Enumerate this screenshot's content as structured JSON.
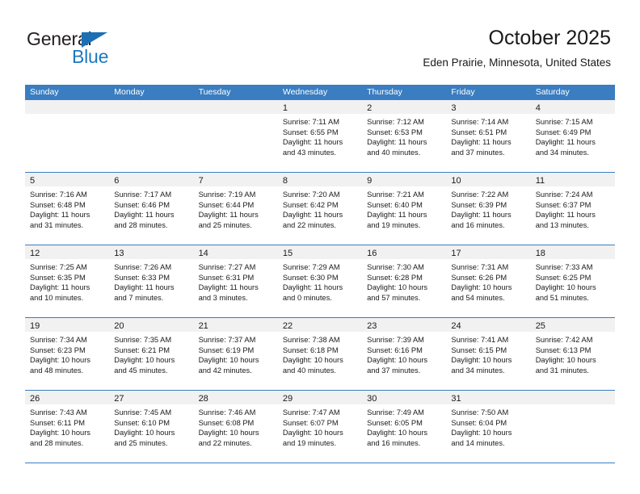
{
  "brand": {
    "word_top": "General",
    "word_bottom": "Blue",
    "triangle_color": "#1c6fb4",
    "blue_text_color": "#1c79c0",
    "icon": "general-blue-logo"
  },
  "header": {
    "title": "October 2025",
    "subtitle": "Eden Prairie, Minnesota, United States"
  },
  "theme": {
    "header_bar_color": "#3a7dc0",
    "daynum_band_color": "#f1f1f1",
    "grid_line_color": "#3a7dc0",
    "text_color": "#1a1a1a"
  },
  "calendar": {
    "weekday_headers": [
      "Sunday",
      "Monday",
      "Tuesday",
      "Wednesday",
      "Thursday",
      "Friday",
      "Saturday"
    ],
    "weeks": [
      [
        {
          "day": "",
          "empty": true,
          "sunrise": "",
          "sunset": "",
          "daylight_line1": "",
          "daylight_line2": ""
        },
        {
          "day": "",
          "empty": true,
          "sunrise": "",
          "sunset": "",
          "daylight_line1": "",
          "daylight_line2": ""
        },
        {
          "day": "",
          "empty": true,
          "sunrise": "",
          "sunset": "",
          "daylight_line1": "",
          "daylight_line2": ""
        },
        {
          "day": "1",
          "empty": false,
          "sunrise": "Sunrise: 7:11 AM",
          "sunset": "Sunset: 6:55 PM",
          "daylight_line1": "Daylight: 11 hours",
          "daylight_line2": "and 43 minutes."
        },
        {
          "day": "2",
          "empty": false,
          "sunrise": "Sunrise: 7:12 AM",
          "sunset": "Sunset: 6:53 PM",
          "daylight_line1": "Daylight: 11 hours",
          "daylight_line2": "and 40 minutes."
        },
        {
          "day": "3",
          "empty": false,
          "sunrise": "Sunrise: 7:14 AM",
          "sunset": "Sunset: 6:51 PM",
          "daylight_line1": "Daylight: 11 hours",
          "daylight_line2": "and 37 minutes."
        },
        {
          "day": "4",
          "empty": false,
          "sunrise": "Sunrise: 7:15 AM",
          "sunset": "Sunset: 6:49 PM",
          "daylight_line1": "Daylight: 11 hours",
          "daylight_line2": "and 34 minutes."
        }
      ],
      [
        {
          "day": "5",
          "empty": false,
          "sunrise": "Sunrise: 7:16 AM",
          "sunset": "Sunset: 6:48 PM",
          "daylight_line1": "Daylight: 11 hours",
          "daylight_line2": "and 31 minutes."
        },
        {
          "day": "6",
          "empty": false,
          "sunrise": "Sunrise: 7:17 AM",
          "sunset": "Sunset: 6:46 PM",
          "daylight_line1": "Daylight: 11 hours",
          "daylight_line2": "and 28 minutes."
        },
        {
          "day": "7",
          "empty": false,
          "sunrise": "Sunrise: 7:19 AM",
          "sunset": "Sunset: 6:44 PM",
          "daylight_line1": "Daylight: 11 hours",
          "daylight_line2": "and 25 minutes."
        },
        {
          "day": "8",
          "empty": false,
          "sunrise": "Sunrise: 7:20 AM",
          "sunset": "Sunset: 6:42 PM",
          "daylight_line1": "Daylight: 11 hours",
          "daylight_line2": "and 22 minutes."
        },
        {
          "day": "9",
          "empty": false,
          "sunrise": "Sunrise: 7:21 AM",
          "sunset": "Sunset: 6:40 PM",
          "daylight_line1": "Daylight: 11 hours",
          "daylight_line2": "and 19 minutes."
        },
        {
          "day": "10",
          "empty": false,
          "sunrise": "Sunrise: 7:22 AM",
          "sunset": "Sunset: 6:39 PM",
          "daylight_line1": "Daylight: 11 hours",
          "daylight_line2": "and 16 minutes."
        },
        {
          "day": "11",
          "empty": false,
          "sunrise": "Sunrise: 7:24 AM",
          "sunset": "Sunset: 6:37 PM",
          "daylight_line1": "Daylight: 11 hours",
          "daylight_line2": "and 13 minutes."
        }
      ],
      [
        {
          "day": "12",
          "empty": false,
          "sunrise": "Sunrise: 7:25 AM",
          "sunset": "Sunset: 6:35 PM",
          "daylight_line1": "Daylight: 11 hours",
          "daylight_line2": "and 10 minutes."
        },
        {
          "day": "13",
          "empty": false,
          "sunrise": "Sunrise: 7:26 AM",
          "sunset": "Sunset: 6:33 PM",
          "daylight_line1": "Daylight: 11 hours",
          "daylight_line2": "and 7 minutes."
        },
        {
          "day": "14",
          "empty": false,
          "sunrise": "Sunrise: 7:27 AM",
          "sunset": "Sunset: 6:31 PM",
          "daylight_line1": "Daylight: 11 hours",
          "daylight_line2": "and 3 minutes."
        },
        {
          "day": "15",
          "empty": false,
          "sunrise": "Sunrise: 7:29 AM",
          "sunset": "Sunset: 6:30 PM",
          "daylight_line1": "Daylight: 11 hours",
          "daylight_line2": "and 0 minutes."
        },
        {
          "day": "16",
          "empty": false,
          "sunrise": "Sunrise: 7:30 AM",
          "sunset": "Sunset: 6:28 PM",
          "daylight_line1": "Daylight: 10 hours",
          "daylight_line2": "and 57 minutes."
        },
        {
          "day": "17",
          "empty": false,
          "sunrise": "Sunrise: 7:31 AM",
          "sunset": "Sunset: 6:26 PM",
          "daylight_line1": "Daylight: 10 hours",
          "daylight_line2": "and 54 minutes."
        },
        {
          "day": "18",
          "empty": false,
          "sunrise": "Sunrise: 7:33 AM",
          "sunset": "Sunset: 6:25 PM",
          "daylight_line1": "Daylight: 10 hours",
          "daylight_line2": "and 51 minutes."
        }
      ],
      [
        {
          "day": "19",
          "empty": false,
          "sunrise": "Sunrise: 7:34 AM",
          "sunset": "Sunset: 6:23 PM",
          "daylight_line1": "Daylight: 10 hours",
          "daylight_line2": "and 48 minutes."
        },
        {
          "day": "20",
          "empty": false,
          "sunrise": "Sunrise: 7:35 AM",
          "sunset": "Sunset: 6:21 PM",
          "daylight_line1": "Daylight: 10 hours",
          "daylight_line2": "and 45 minutes."
        },
        {
          "day": "21",
          "empty": false,
          "sunrise": "Sunrise: 7:37 AM",
          "sunset": "Sunset: 6:19 PM",
          "daylight_line1": "Daylight: 10 hours",
          "daylight_line2": "and 42 minutes."
        },
        {
          "day": "22",
          "empty": false,
          "sunrise": "Sunrise: 7:38 AM",
          "sunset": "Sunset: 6:18 PM",
          "daylight_line1": "Daylight: 10 hours",
          "daylight_line2": "and 40 minutes."
        },
        {
          "day": "23",
          "empty": false,
          "sunrise": "Sunrise: 7:39 AM",
          "sunset": "Sunset: 6:16 PM",
          "daylight_line1": "Daylight: 10 hours",
          "daylight_line2": "and 37 minutes."
        },
        {
          "day": "24",
          "empty": false,
          "sunrise": "Sunrise: 7:41 AM",
          "sunset": "Sunset: 6:15 PM",
          "daylight_line1": "Daylight: 10 hours",
          "daylight_line2": "and 34 minutes."
        },
        {
          "day": "25",
          "empty": false,
          "sunrise": "Sunrise: 7:42 AM",
          "sunset": "Sunset: 6:13 PM",
          "daylight_line1": "Daylight: 10 hours",
          "daylight_line2": "and 31 minutes."
        }
      ],
      [
        {
          "day": "26",
          "empty": false,
          "sunrise": "Sunrise: 7:43 AM",
          "sunset": "Sunset: 6:11 PM",
          "daylight_line1": "Daylight: 10 hours",
          "daylight_line2": "and 28 minutes."
        },
        {
          "day": "27",
          "empty": false,
          "sunrise": "Sunrise: 7:45 AM",
          "sunset": "Sunset: 6:10 PM",
          "daylight_line1": "Daylight: 10 hours",
          "daylight_line2": "and 25 minutes."
        },
        {
          "day": "28",
          "empty": false,
          "sunrise": "Sunrise: 7:46 AM",
          "sunset": "Sunset: 6:08 PM",
          "daylight_line1": "Daylight: 10 hours",
          "daylight_line2": "and 22 minutes."
        },
        {
          "day": "29",
          "empty": false,
          "sunrise": "Sunrise: 7:47 AM",
          "sunset": "Sunset: 6:07 PM",
          "daylight_line1": "Daylight: 10 hours",
          "daylight_line2": "and 19 minutes."
        },
        {
          "day": "30",
          "empty": false,
          "sunrise": "Sunrise: 7:49 AM",
          "sunset": "Sunset: 6:05 PM",
          "daylight_line1": "Daylight: 10 hours",
          "daylight_line2": "and 16 minutes."
        },
        {
          "day": "31",
          "empty": false,
          "sunrise": "Sunrise: 7:50 AM",
          "sunset": "Sunset: 6:04 PM",
          "daylight_line1": "Daylight: 10 hours",
          "daylight_line2": "and 14 minutes."
        },
        {
          "day": "",
          "empty": true,
          "sunrise": "",
          "sunset": "",
          "daylight_line1": "",
          "daylight_line2": ""
        }
      ]
    ]
  }
}
